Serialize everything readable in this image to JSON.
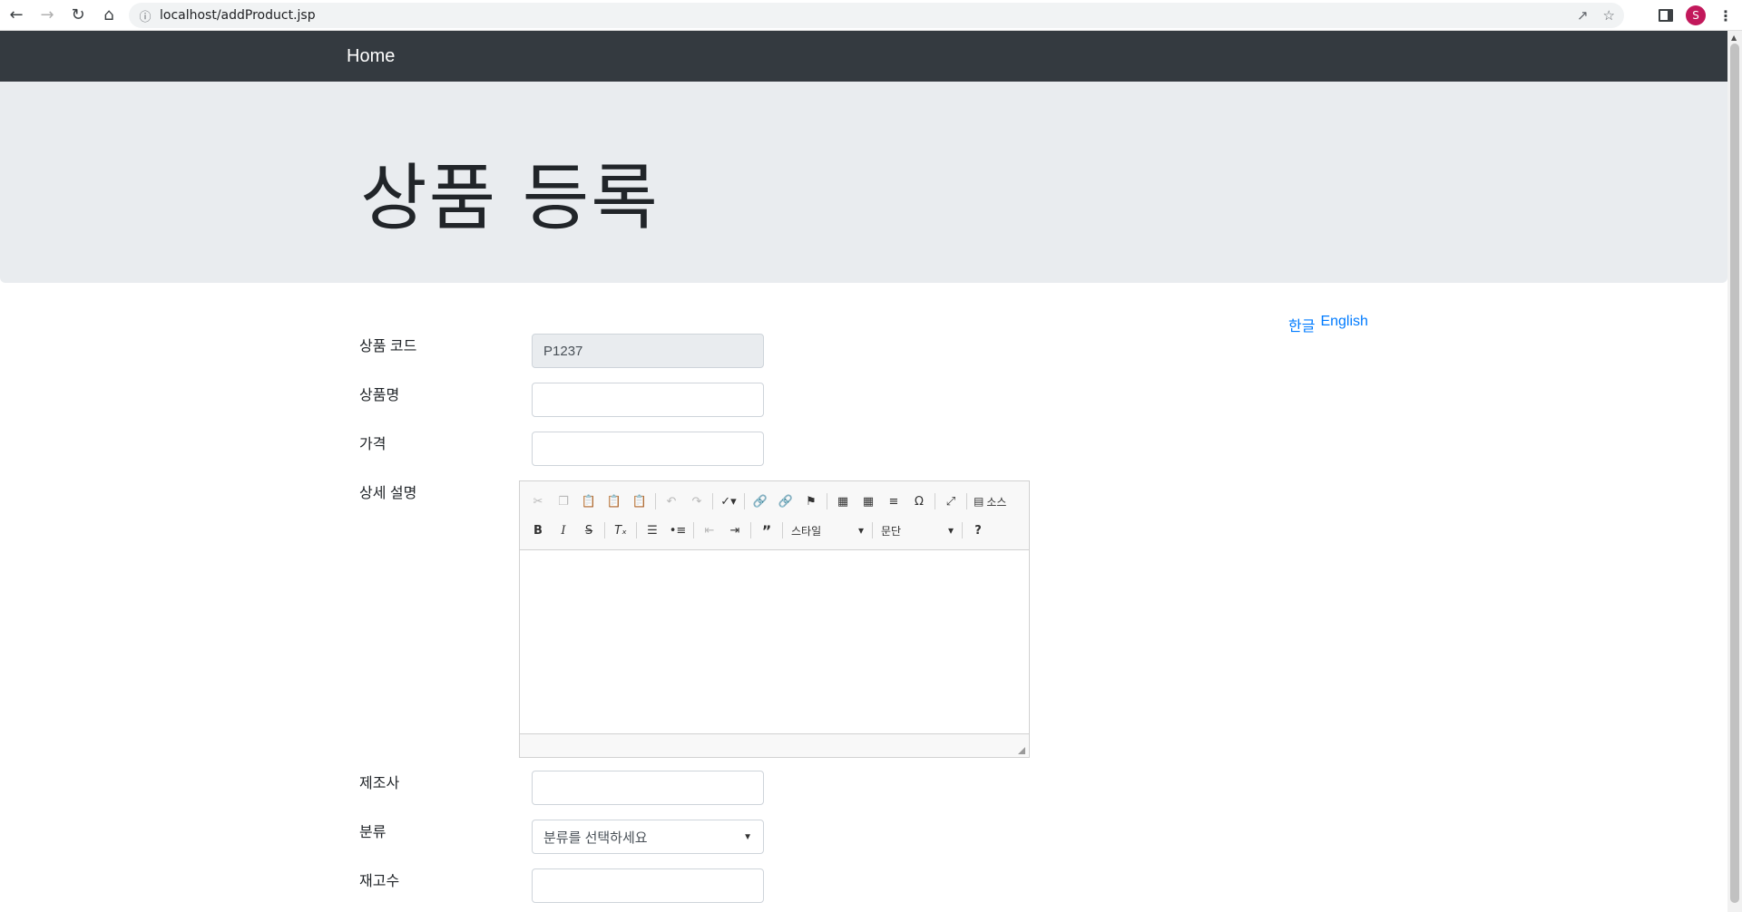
{
  "browser": {
    "url": "localhost/addProduct.jsp",
    "avatar_letter": "S"
  },
  "navbar": {
    "brand": "Home"
  },
  "jumbotron": {
    "title": "상품 등록"
  },
  "lang": {
    "korean": "한글",
    "english": "English"
  },
  "form": {
    "product_id_label": "상품 코드",
    "product_id_value": "P1237",
    "name_label": "상품명",
    "name_value": "",
    "price_label": "가격",
    "price_value": "",
    "description_label": "상세 설명",
    "manufacturer_label": "제조사",
    "manufacturer_value": "",
    "category_label": "분류",
    "category_selected": "분류를 선택하세요",
    "stock_label": "재고수",
    "stock_value": ""
  },
  "editor": {
    "source_label": "소스",
    "style_combo": "스타일",
    "format_combo": "문단"
  }
}
